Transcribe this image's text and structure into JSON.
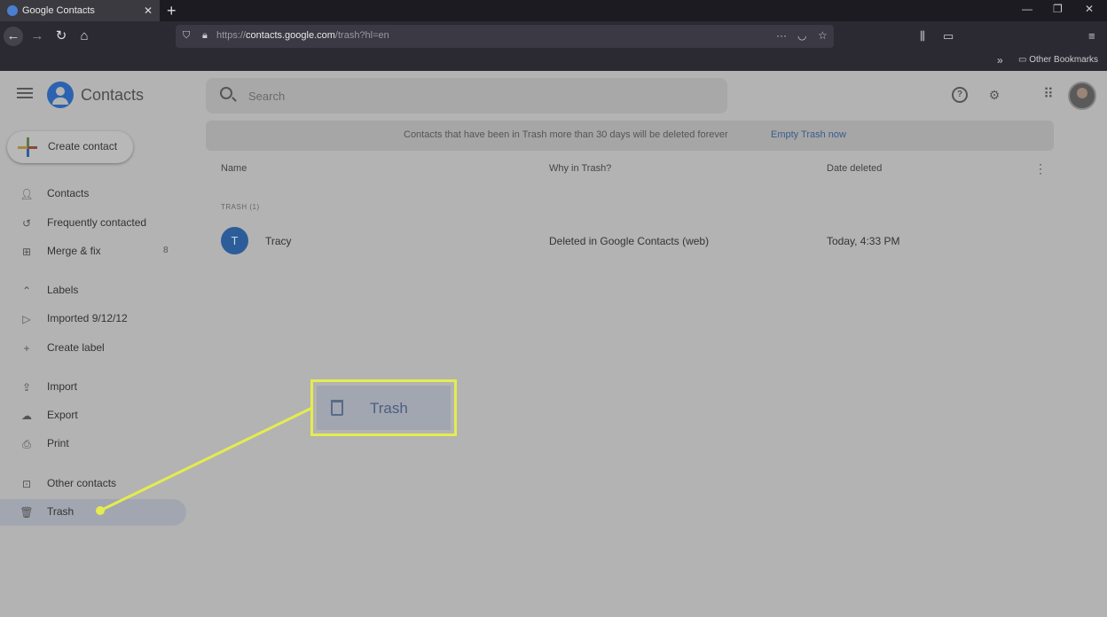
{
  "browser": {
    "tab_title": "Google Contacts",
    "tab_close": "✕",
    "new_tab": "+",
    "url_prefix": "https://",
    "url_host": "contacts.google.com",
    "url_suffix": "/trash?hl=en",
    "page_actions": "···",
    "bookmarks_folder": "Other Bookmarks"
  },
  "app": {
    "title": "Contacts",
    "search_placeholder": "Search",
    "create_label": "Create contact"
  },
  "sidebar": {
    "items": [
      {
        "label": "Contacts"
      },
      {
        "label": "Frequently contacted"
      },
      {
        "label": "Merge & fix",
        "count": "8"
      },
      {
        "label": "Labels"
      },
      {
        "label": "Imported 9/12/12"
      },
      {
        "label": "Create label"
      },
      {
        "label": "Import"
      },
      {
        "label": "Export"
      },
      {
        "label": "Print"
      },
      {
        "label": "Other contacts"
      },
      {
        "label": "Trash"
      }
    ]
  },
  "banner": {
    "text": "Contacts that have been in Trash more than 30 days will be deleted forever",
    "link": "Empty Trash now"
  },
  "table": {
    "headers": [
      "Name",
      "Why in Trash?",
      "Date deleted"
    ],
    "group_label": "TRASH (1)",
    "rows": [
      {
        "initial": "T",
        "name": "Tracy",
        "why": "Deleted in Google Contacts (web)",
        "date": "Today, 4:33 PM"
      }
    ]
  },
  "callout": {
    "label": "Trash",
    "accent": "#e4ec4e"
  },
  "icons": {
    "back": "arrow-left-icon",
    "forward": "arrow-right-icon",
    "reload": "reload-icon",
    "home": "home-icon",
    "search": "search-icon",
    "help": "help-icon",
    "settings": "gear-icon",
    "apps": "apps-grid-icon",
    "trash": "trash-icon"
  }
}
